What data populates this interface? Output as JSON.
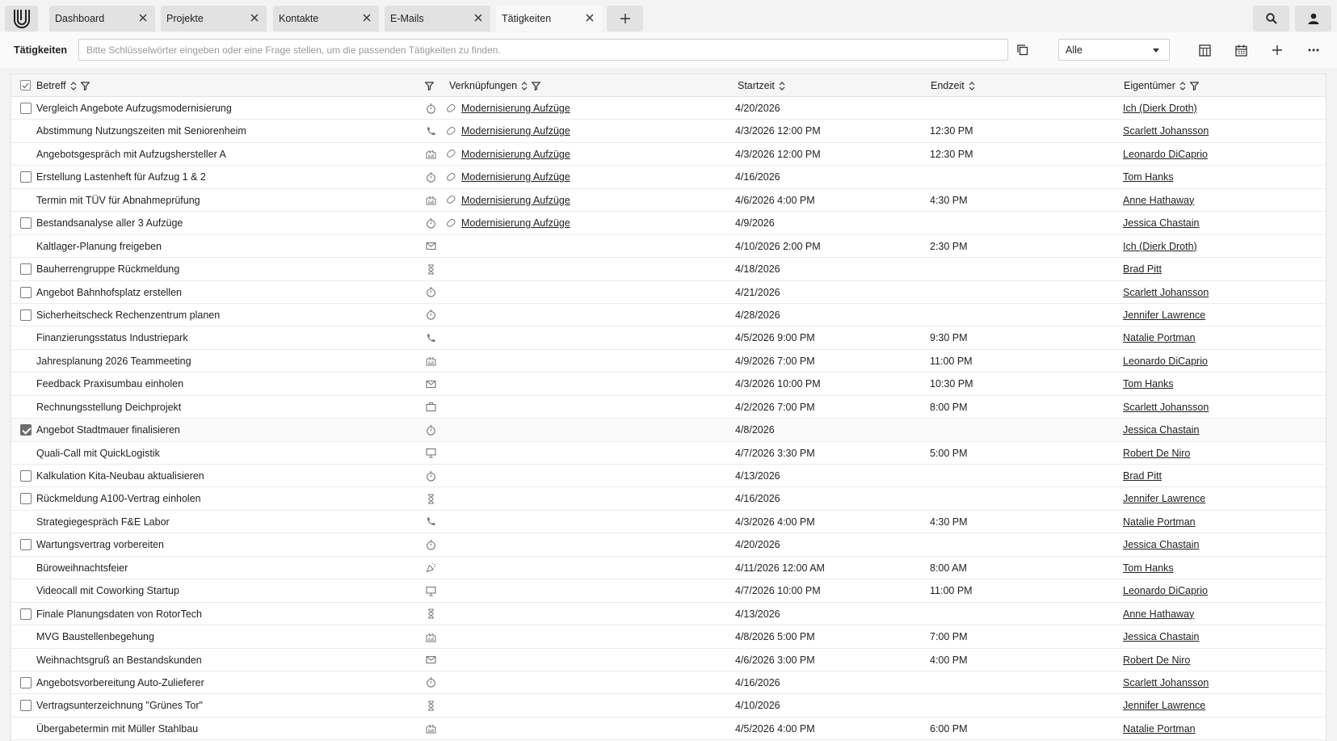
{
  "tabs": [
    {
      "label": "Dashboard",
      "active": false
    },
    {
      "label": "Projekte",
      "active": false
    },
    {
      "label": "Kontakte",
      "active": false
    },
    {
      "label": "E-Mails",
      "active": false
    },
    {
      "label": "Tätigkeiten",
      "active": true
    }
  ],
  "toolbar": {
    "title": "Tätigkeiten",
    "search_placeholder": "Bitte Schlüsselwörter eingeben oder eine Frage stellen, um die passenden Tätigkeiten zu finden.",
    "filter_value": "Alle"
  },
  "columns": {
    "betreff": "Betreff",
    "verknuepfungen": "Verknüpfungen",
    "startzeit": "Startzeit",
    "endzeit": "Endzeit",
    "eigentuemer": "Eigentümer"
  },
  "rows": [
    {
      "checkbox": "unchecked",
      "subject": "Vergleich Angebote Aufzugsmodernisierung",
      "type": "timer-icon",
      "link": "Modernisierung Aufzüge",
      "start": "4/20/2026",
      "end": "",
      "owner": "Ich (Dierk Droth)"
    },
    {
      "checkbox": "none",
      "subject": "Abstimmung Nutzungszeiten mit Seniorenheim",
      "type": "phone-icon",
      "link": "Modernisierung Aufzüge",
      "start": "4/3/2026 12:00 PM",
      "end": "12:30 PM",
      "owner": "Scarlett Johansson"
    },
    {
      "checkbox": "none",
      "subject": "Angebotsgespräch mit Aufzugshersteller A",
      "type": "meeting-icon",
      "link": "Modernisierung Aufzüge",
      "start": "4/3/2026 12:00 PM",
      "end": "12:30 PM",
      "owner": "Leonardo DiCaprio"
    },
    {
      "checkbox": "unchecked",
      "subject": "Erstellung Lastenheft für Aufzug 1 & 2",
      "type": "timer-icon",
      "link": "Modernisierung Aufzüge",
      "start": "4/16/2026",
      "end": "",
      "owner": "Tom Hanks"
    },
    {
      "checkbox": "none",
      "subject": "Termin mit TÜV für Abnahmeprüfung",
      "type": "meeting-icon",
      "link": "Modernisierung Aufzüge",
      "start": "4/6/2026 4:00 PM",
      "end": "4:30 PM",
      "owner": "Anne Hathaway"
    },
    {
      "checkbox": "unchecked",
      "subject": "Bestandsanalyse aller 3 Aufzüge",
      "type": "timer-icon",
      "link": "Modernisierung Aufzüge",
      "start": "4/9/2026",
      "end": "",
      "owner": "Jessica Chastain"
    },
    {
      "checkbox": "none",
      "subject": "Kaltlager-Planung freigeben",
      "type": "mail-icon",
      "link": "",
      "start": "4/10/2026 2:00 PM",
      "end": "2:30 PM",
      "owner": "Ich (Dierk Droth)"
    },
    {
      "checkbox": "unchecked",
      "subject": "Bauherrengruppe Rückmeldung",
      "type": "hourglass-icon",
      "link": "",
      "start": "4/18/2026",
      "end": "",
      "owner": "Brad Pitt"
    },
    {
      "checkbox": "unchecked",
      "subject": "Angebot Bahnhofsplatz erstellen",
      "type": "timer-icon",
      "link": "",
      "start": "4/21/2026",
      "end": "",
      "owner": "Scarlett Johansson"
    },
    {
      "checkbox": "unchecked",
      "subject": "Sicherheitscheck Rechenzentrum planen",
      "type": "timer-icon",
      "link": "",
      "start": "4/28/2026",
      "end": "",
      "owner": "Jennifer Lawrence"
    },
    {
      "checkbox": "none",
      "subject": "Finanzierungsstatus Industriepark",
      "type": "phone-icon",
      "link": "",
      "start": "4/5/2026 9:00 PM",
      "end": "9:30 PM",
      "owner": "Natalie Portman"
    },
    {
      "checkbox": "none",
      "subject": "Jahresplanung 2026 Teammeeting",
      "type": "meeting-icon",
      "link": "",
      "start": "4/9/2026 7:00 PM",
      "end": "11:00 PM",
      "owner": "Leonardo DiCaprio"
    },
    {
      "checkbox": "none",
      "subject": "Feedback Praxisumbau einholen",
      "type": "mail-icon",
      "link": "",
      "start": "4/3/2026 10:00 PM",
      "end": "10:30 PM",
      "owner": "Tom Hanks"
    },
    {
      "checkbox": "none",
      "subject": "Rechnungsstellung Deichprojekt",
      "type": "briefcase-icon",
      "link": "",
      "start": "4/2/2026 7:00 PM",
      "end": "8:00 PM",
      "owner": "Scarlett Johansson"
    },
    {
      "checkbox": "checked",
      "subject": "Angebot Stadtmauer finalisieren",
      "type": "timer-icon",
      "link": "",
      "start": "4/8/2026",
      "end": "",
      "owner": "Jessica Chastain"
    },
    {
      "checkbox": "none",
      "subject": "Quali-Call mit QuickLogistik",
      "type": "monitor-icon",
      "link": "",
      "start": "4/7/2026 3:30 PM",
      "end": "5:00 PM",
      "owner": "Robert De Niro"
    },
    {
      "checkbox": "unchecked",
      "subject": "Kalkulation Kita-Neubau aktualisieren",
      "type": "timer-icon",
      "link": "",
      "start": "4/13/2026",
      "end": "",
      "owner": "Brad Pitt"
    },
    {
      "checkbox": "unchecked",
      "subject": "Rückmeldung A100-Vertrag einholen",
      "type": "hourglass-icon",
      "link": "",
      "start": "4/16/2026",
      "end": "",
      "owner": "Jennifer Lawrence"
    },
    {
      "checkbox": "none",
      "subject": "Strategiegespräch F&E Labor",
      "type": "phone-icon",
      "link": "",
      "start": "4/3/2026 4:00 PM",
      "end": "4:30 PM",
      "owner": "Natalie Portman"
    },
    {
      "checkbox": "unchecked",
      "subject": "Wartungsvertrag vorbereiten",
      "type": "timer-icon",
      "link": "",
      "start": "4/20/2026",
      "end": "",
      "owner": "Jessica Chastain"
    },
    {
      "checkbox": "none",
      "subject": "Büroweihnachtsfeier",
      "type": "party-icon",
      "link": "",
      "start": "4/11/2026 12:00 AM",
      "end": "8:00 AM",
      "owner": "Tom Hanks"
    },
    {
      "checkbox": "none",
      "subject": "Videocall mit Coworking Startup",
      "type": "monitor-icon",
      "link": "",
      "start": "4/7/2026 10:00 PM",
      "end": "11:00 PM",
      "owner": "Leonardo DiCaprio"
    },
    {
      "checkbox": "unchecked",
      "subject": "Finale Planungsdaten von RotorTech",
      "type": "hourglass-icon",
      "link": "",
      "start": "4/13/2026",
      "end": "",
      "owner": "Anne Hathaway"
    },
    {
      "checkbox": "none",
      "subject": "MVG Baustellenbegehung",
      "type": "meeting-icon",
      "link": "",
      "start": "4/8/2026 5:00 PM",
      "end": "7:00 PM",
      "owner": "Jessica Chastain"
    },
    {
      "checkbox": "none",
      "subject": "Weihnachtsgruß an Bestandskunden",
      "type": "mail-icon",
      "link": "",
      "start": "4/6/2026 3:00 PM",
      "end": "4:00 PM",
      "owner": "Robert De Niro"
    },
    {
      "checkbox": "unchecked",
      "subject": "Angebotsvorbereitung Auto-Zulieferer",
      "type": "timer-icon",
      "link": "",
      "start": "4/16/2026",
      "end": "",
      "owner": "Scarlett Johansson"
    },
    {
      "checkbox": "unchecked",
      "subject": "Vertragsunterzeichnung \"Grünes Tor\"",
      "type": "hourglass-icon",
      "link": "",
      "start": "4/10/2026",
      "end": "",
      "owner": "Jennifer Lawrence"
    },
    {
      "checkbox": "none",
      "subject": "Übergabetermin mit Müller Stahlbau",
      "type": "meeting-icon",
      "link": "",
      "start": "4/5/2026 4:00 PM",
      "end": "6:00 PM",
      "owner": "Natalie Portman"
    }
  ]
}
